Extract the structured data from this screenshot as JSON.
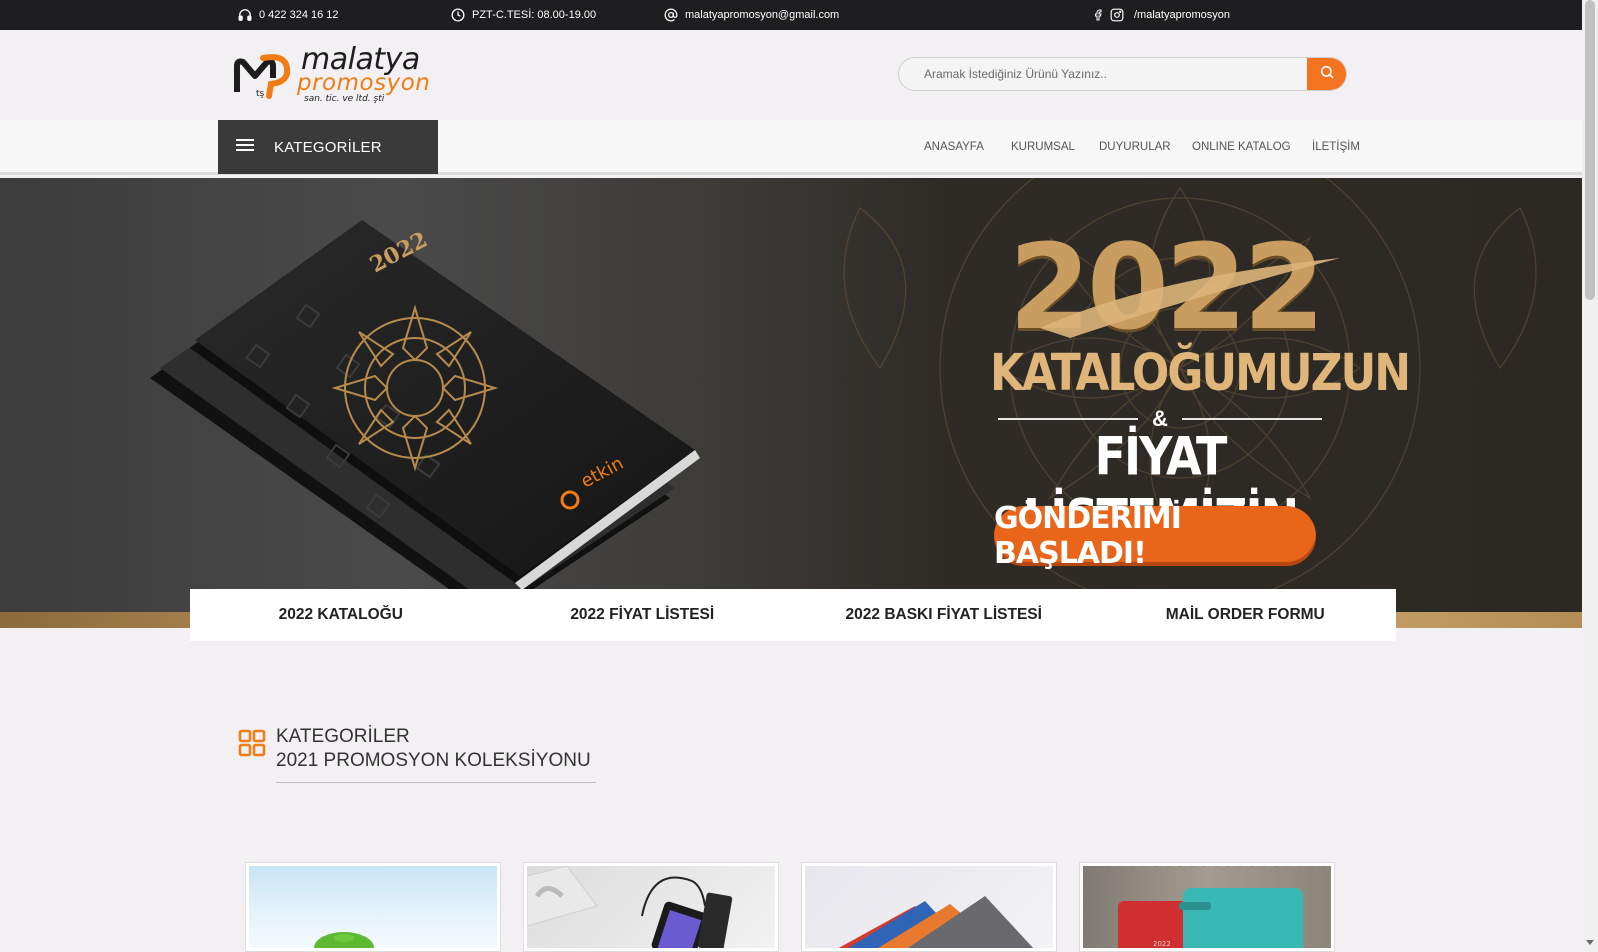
{
  "topbar": {
    "phone": "0 422 324 16 12",
    "hours": "PZT-C.TESİ: 08.00-19.00",
    "email": "malatyapromosyon@gmail.com",
    "social": "/malatyapromosyon"
  },
  "logo": {
    "line1": "malatya",
    "line2": "promosyon",
    "line3": "san. tic. ve ltd. şti"
  },
  "search": {
    "placeholder": "Aramak İstediğiniz Ürünü Yazınız.."
  },
  "nav": {
    "categories_label": "KATEGORİLER",
    "menu": [
      "ANASAYFA",
      "KURUMSAL",
      "DUYURULAR",
      "ONLINE KATALOG",
      "İLETİŞİM"
    ]
  },
  "hero": {
    "year": "2022",
    "line1": "KATALOĞUMUZUN",
    "amp": "&",
    "line2": "FİYAT LİSTEMİZİN",
    "pill": "GÖNDERİMİ BAŞLADI!",
    "book_brand": "etkin"
  },
  "quick_links": [
    "2022 KATALOĞU",
    "2022 FİYAT LİSTESİ",
    "2022 BASKI FİYAT LİSTESİ",
    "MAİL ORDER FORMU"
  ],
  "section": {
    "title": "KATEGORİLER",
    "subtitle": "2021 PROMOSYON KOLEKSİYONU"
  },
  "colors": {
    "accent": "#f37321",
    "topbar": "#1e1e20",
    "category_button": "#3a3a3a",
    "gold": "#c99d5f"
  },
  "icons": [
    "headphones-icon",
    "clock-icon",
    "at-icon",
    "facebook-icon",
    "instagram-icon",
    "search-icon",
    "hamburger-icon",
    "grid-icon"
  ]
}
